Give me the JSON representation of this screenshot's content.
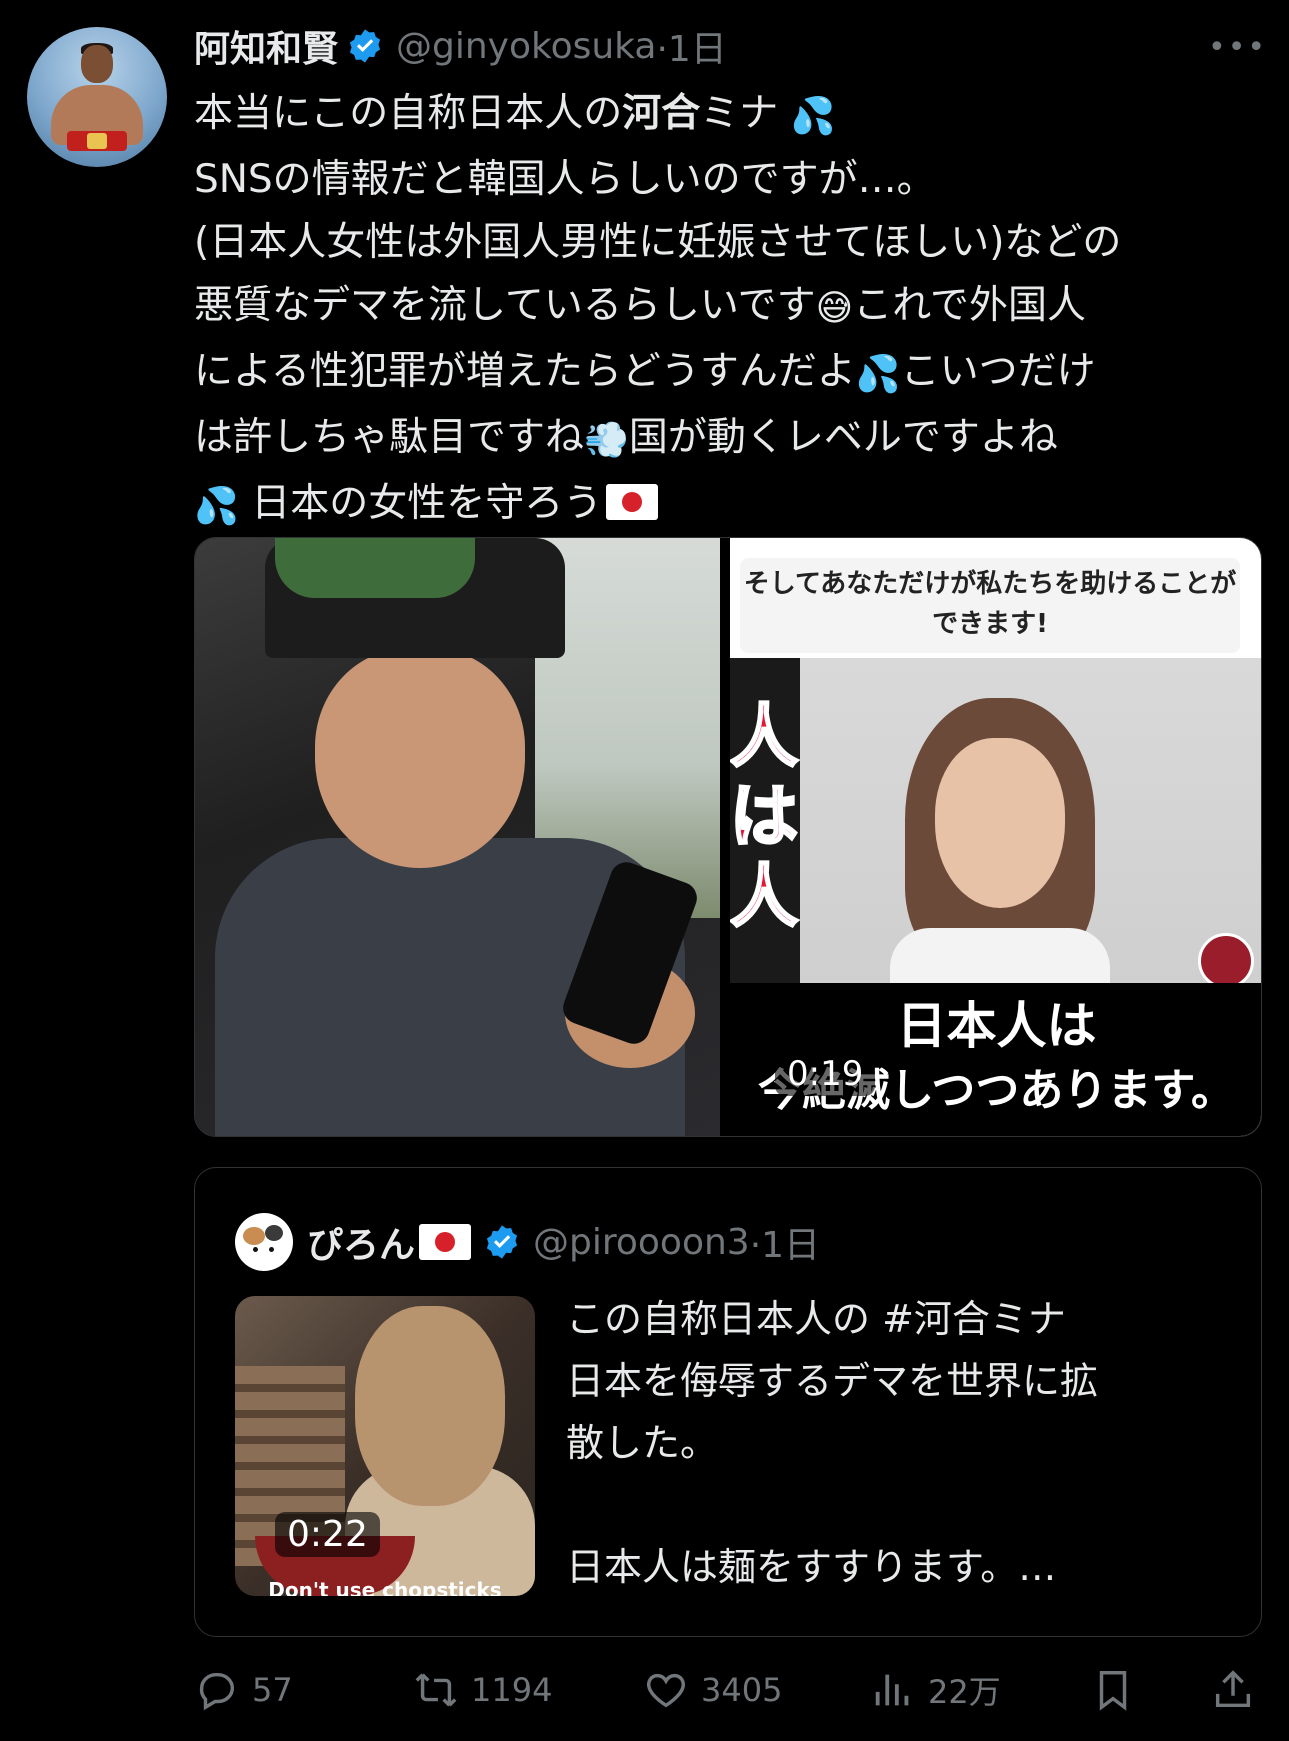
{
  "author": {
    "name": "阿知和賢",
    "handle": "@ginyokosuka",
    "time": "·1日"
  },
  "more_label": "•••",
  "body_lines": {
    "l1a": "本当にこの自称日本人の",
    "l1b": "河合",
    "l1c": "ミナ",
    "l2": "SNSの情報だと韓国人らしいのですが…。",
    "l3": "(日本人女性は外国人男性に妊娠させてほしい)などの",
    "l4a": "悪質なデマを流しているらしいです",
    "l4b": "これで外国人",
    "l5a": "による性犯罪が増えたらどうすんだよ",
    "l5b": "こいつだけ",
    "l6a": "は許しちゃ駄目ですね",
    "l6b": "国が動くレベルですよね",
    "l7": "日本の女性を守ろう"
  },
  "emoji": {
    "sweat": "💦",
    "grin_sweat": "😅",
    "dash": "💨"
  },
  "media": {
    "caption_top": "そしてあなただけが私たちを助けることができます!",
    "side_text": "人は人",
    "bottom_line1": "日本人は",
    "bottom_line2": "今絶滅しつつあります。",
    "duration": "0:19"
  },
  "quote": {
    "name": "ぴろん",
    "handle": "@piroooon3",
    "time": "·1日",
    "thumb_subtitle": "Don't use chopsticks",
    "duration": "0:22",
    "text_l1": "この自称日本人の #河合ミナ",
    "text_l2": "日本を侮辱するデマを世界に拡",
    "text_l3": "散した。",
    "text_l4": "日本人は麺をすすります。…"
  },
  "actions": {
    "replies": "57",
    "reposts": "1194",
    "likes": "3405",
    "views": "22万"
  },
  "colors": {
    "background": "#000000",
    "text": "#e7e9ea",
    "muted": "#71767b",
    "verified": "#1d9bf0",
    "border": "#2f3336"
  },
  "icons": [
    "verified-badge-icon",
    "more-icon",
    "reply-icon",
    "repost-icon",
    "like-icon",
    "views-icon",
    "bookmark-icon",
    "share-icon"
  ]
}
